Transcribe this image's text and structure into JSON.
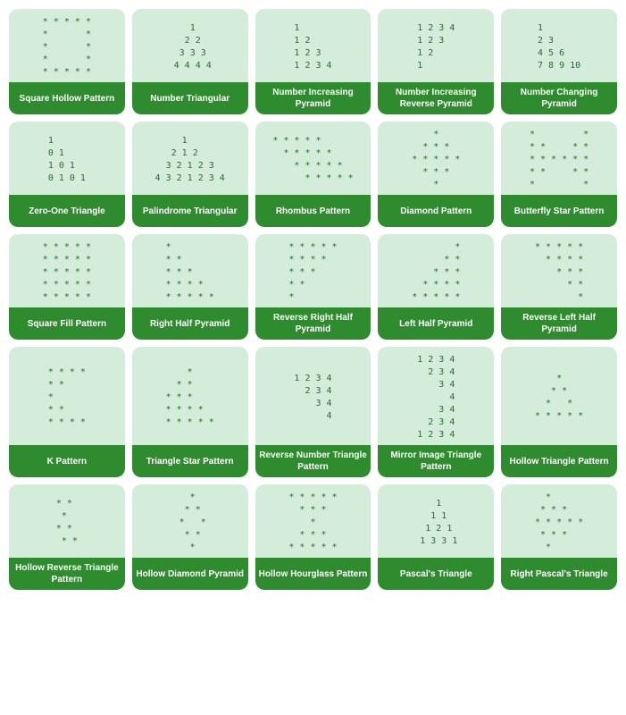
{
  "cards": [
    {
      "id": "square-hollow-pattern",
      "label": "Square Hollow Pattern",
      "pattern": "* * * * *\n*       *\n*       *\n*       *\n* * * * *"
    },
    {
      "id": "number-triangular",
      "label": "Number Triangular",
      "pattern": "    1\n   2 2\n  3 3 3\n 4 4 4 4"
    },
    {
      "id": "number-increasing-pyramid",
      "label": "Number Increasing Pyramid",
      "pattern": "1\n1 2\n1 2 3\n1 2 3 4"
    },
    {
      "id": "number-increasing-reverse-pyramid",
      "label": "Number Increasing Reverse Pyramid",
      "pattern": "1 2 3 4\n1 2 3\n1 2\n1"
    },
    {
      "id": "number-changing-pyramid",
      "label": "Number Changing Pyramid",
      "pattern": "1\n2 3\n4 5 6\n7 8 9 10"
    },
    {
      "id": "zero-one-triangle",
      "label": "Zero-One Triangle",
      "pattern": "1\n0 1\n1 0 1\n0 1 0 1"
    },
    {
      "id": "palindrome-triangular",
      "label": "Palindrome Triangular",
      "pattern": "    1\n   2 1 2\n  3 2 1 2 3\n 4 3 2 1 2 3 4"
    },
    {
      "id": "rhombus-pattern",
      "label": "Rhombus Pattern",
      "pattern": "* * * * *\n * * * * *\n  * * * * *\n   * * * * *"
    },
    {
      "id": "diamond-pattern",
      "label": "Diamond Pattern",
      "pattern": "  *\n * * *\n* * * * *\n * * *\n  *"
    },
    {
      "id": "butterfly-star-pattern",
      "label": "Butterfly Star Pattern",
      "pattern": "*       *\n* *   * *\n* * * * *\n* *   * *\n*       *"
    },
    {
      "id": "square-fill-pattern",
      "label": "Square Fill Pattern",
      "pattern": "* * * * *\n* * * * *\n* * * * *\n* * * * *\n* * * * *"
    },
    {
      "id": "right-half-pyramid",
      "label": "Right Half Pyramid",
      "pattern": "*\n* *\n* * *\n* * * *\n* * * * *"
    },
    {
      "id": "reverse-right-half-pyramid",
      "label": "Reverse Right Half Pyramid",
      "pattern": "* * * * *\n* * * *\n* * *\n* *\n*"
    },
    {
      "id": "left-half-pyramid",
      "label": "Left Half Pyramid",
      "pattern": "        *\n      * *\n    * * *\n  * * * *\n* * * * *"
    },
    {
      "id": "reverse-left-half-pyramid",
      "label": "Reverse Left Half Pyramid",
      "pattern": "* * * * *\n  * * * *\n    * * *\n      * *\n        *"
    },
    {
      "id": "k-pattern",
      "label": "K Pattern",
      "pattern": "* * * *\n* *\n*\n* *\n* * * *"
    },
    {
      "id": "triangle-star-pattern",
      "label": "Triangle Star Pattern",
      "pattern": "  *\n * * *\n* * * * *\n * * * *\n* * * * *"
    },
    {
      "id": "reverse-number-triangle-pattern",
      "label": "Reverse Number Triangle Pattern",
      "pattern": "1 2 3 4\n  2 3 4\n    3 4\n      4"
    },
    {
      "id": "mirror-image-triangle-pattern",
      "label": "Mirror Image Triangle Pattern",
      "pattern": "1 2 3 4\n  2 3 4\n    3 4\n      4\n    3 4\n  2 3 4\n1 2 3 4"
    },
    {
      "id": "hollow-triangle-pattern",
      "label": "Hollow Triangle Pattern",
      "pattern": "  *\n * *\n*   *\n* * * *"
    },
    {
      "id": "hollow-reverse-triangle-pattern",
      "label": "Hollow Reverse Triangle Pattern",
      "pattern": "* *\n *\n* *\n * *"
    },
    {
      "id": "hollow-diamond-pyramid",
      "label": "Hollow Diamond Pyramid",
      "pattern": "  *\n *   *\n*     *\n *   *\n  *"
    },
    {
      "id": "hollow-hourglass-pattern",
      "label": "Hollow Hourglass Pattern",
      "pattern": "* * * *\n * * *\n  * *\n * * *\n* * * *"
    },
    {
      "id": "pascals-triangle",
      "label": "Pascal's Triangle",
      "pattern": "   1\n  1 1\n 1 2 1\n1 3 3 1"
    },
    {
      "id": "right-pascals-triangle",
      "label": "Right Pascal's Triangle",
      "pattern": "  *\n * * *\n* * * * *\n * * * *\n* * * * *"
    }
  ]
}
